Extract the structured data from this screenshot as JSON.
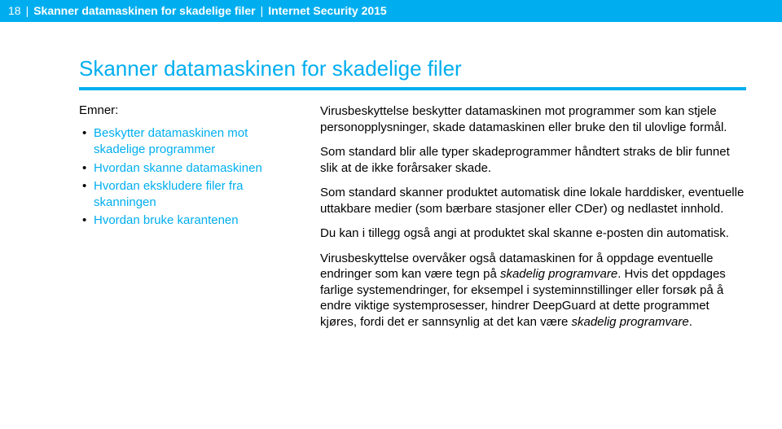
{
  "header": {
    "page_number": "18",
    "divider": "|",
    "breadcrumb1": "Skanner datamaskinen for skadelige filer",
    "breadcrumb2": "Internet Security 2015"
  },
  "title": "Skanner datamaskinen for skadelige filer",
  "sidebar": {
    "label": "Emner:",
    "topics": [
      "Beskytter datamaskinen mot skadelige programmer",
      "Hvordan skanne datamaskinen",
      "Hvordan ekskludere filer fra skanningen",
      "Hvordan bruke karantenen"
    ]
  },
  "body": {
    "p1": "Virusbeskyttelse beskytter datamaskinen mot programmer som kan stjele personopplysninger, skade datamaskinen eller bruke den til ulovlige formål.",
    "p2": "Som standard blir alle typer skadeprogrammer håndtert straks de blir funnet slik at de ikke forårsaker skade.",
    "p3": "Som standard skanner produktet automatisk dine lokale harddisker, eventuelle uttakbare medier (som bærbare stasjoner eller CDer) og nedlastet innhold.",
    "p4": "Du kan i tillegg også angi at produktet skal skanne e-posten din automatisk.",
    "p5_prefix": "Virusbeskyttelse overvåker også datamaskinen for å oppdage eventuelle endringer som kan være tegn på ",
    "p5_italic1": "skadelig programvare",
    "p5_mid": ". Hvis det oppdages farlige systemendringer, for eksempel i systeminnstillinger eller forsøk på å endre viktige systemprosesser, hindrer DeepGuard at dette programmet kjøres, fordi det er sannsynlig at det kan være ",
    "p5_italic2": "skadelig programvare",
    "p5_suffix": "."
  }
}
